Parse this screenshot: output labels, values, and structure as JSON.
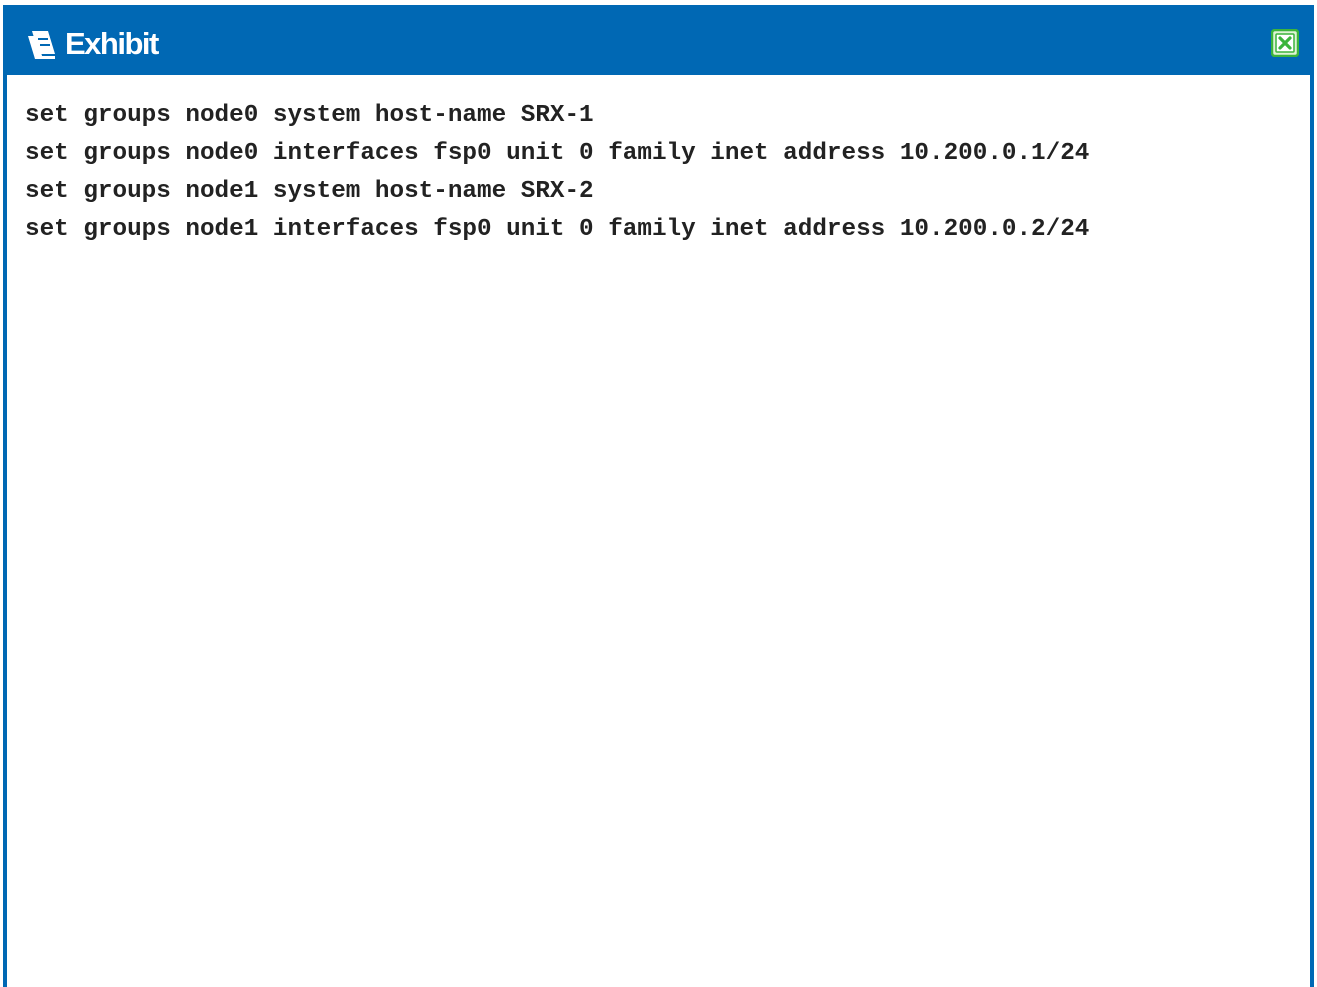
{
  "window": {
    "title": "Exhibit",
    "title_icon": "exhibit-book-icon",
    "close_icon": "close-icon",
    "accent_color": "#0068b4",
    "close_color": "#3cb43c"
  },
  "content": {
    "lines": [
      "set groups node0 system host-name SRX-1",
      "set groups node0 interfaces fsp0 unit 0 family inet address 10.200.0.1/24",
      "set groups node1 system host-name SRX-2",
      "set groups node1 interfaces fsp0 unit 0 family inet address 10.200.0.2/24"
    ]
  }
}
